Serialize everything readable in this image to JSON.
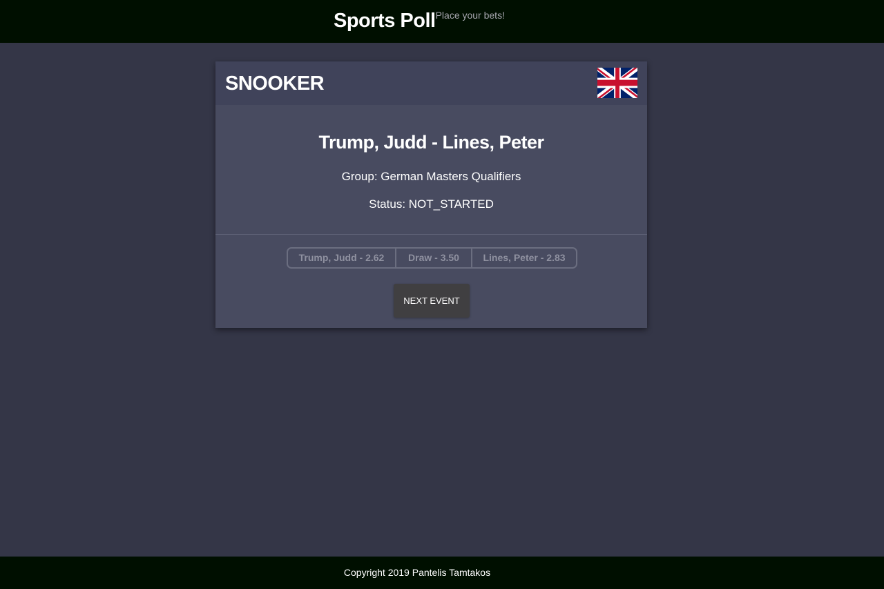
{
  "header": {
    "title": "Sports Poll",
    "tagline": "Place your bets!"
  },
  "event_card": {
    "sport": "SNOOKER",
    "flag_icon": "uk-flag-icon",
    "match_title": "Trump, Judd - Lines, Peter",
    "group": "Group: German Masters Qualifiers",
    "status": "Status: NOT_STARTED",
    "odds": [
      {
        "label": "Trump, Judd - 2.62"
      },
      {
        "label": "Draw - 3.50"
      },
      {
        "label": "Lines, Peter - 2.83"
      }
    ],
    "next_button": "NEXT EVENT"
  },
  "footer": {
    "copyright": "Copyright 2019 Pantelis Tamtakos"
  },
  "colors": {
    "page_bg": "#343647",
    "bar_bg": "#000f00",
    "card_bg": "#484b60",
    "card_header_bg": "#40435a",
    "button_bg": "#403f41",
    "flag_blue": "#012169",
    "flag_red": "#c8102e"
  }
}
